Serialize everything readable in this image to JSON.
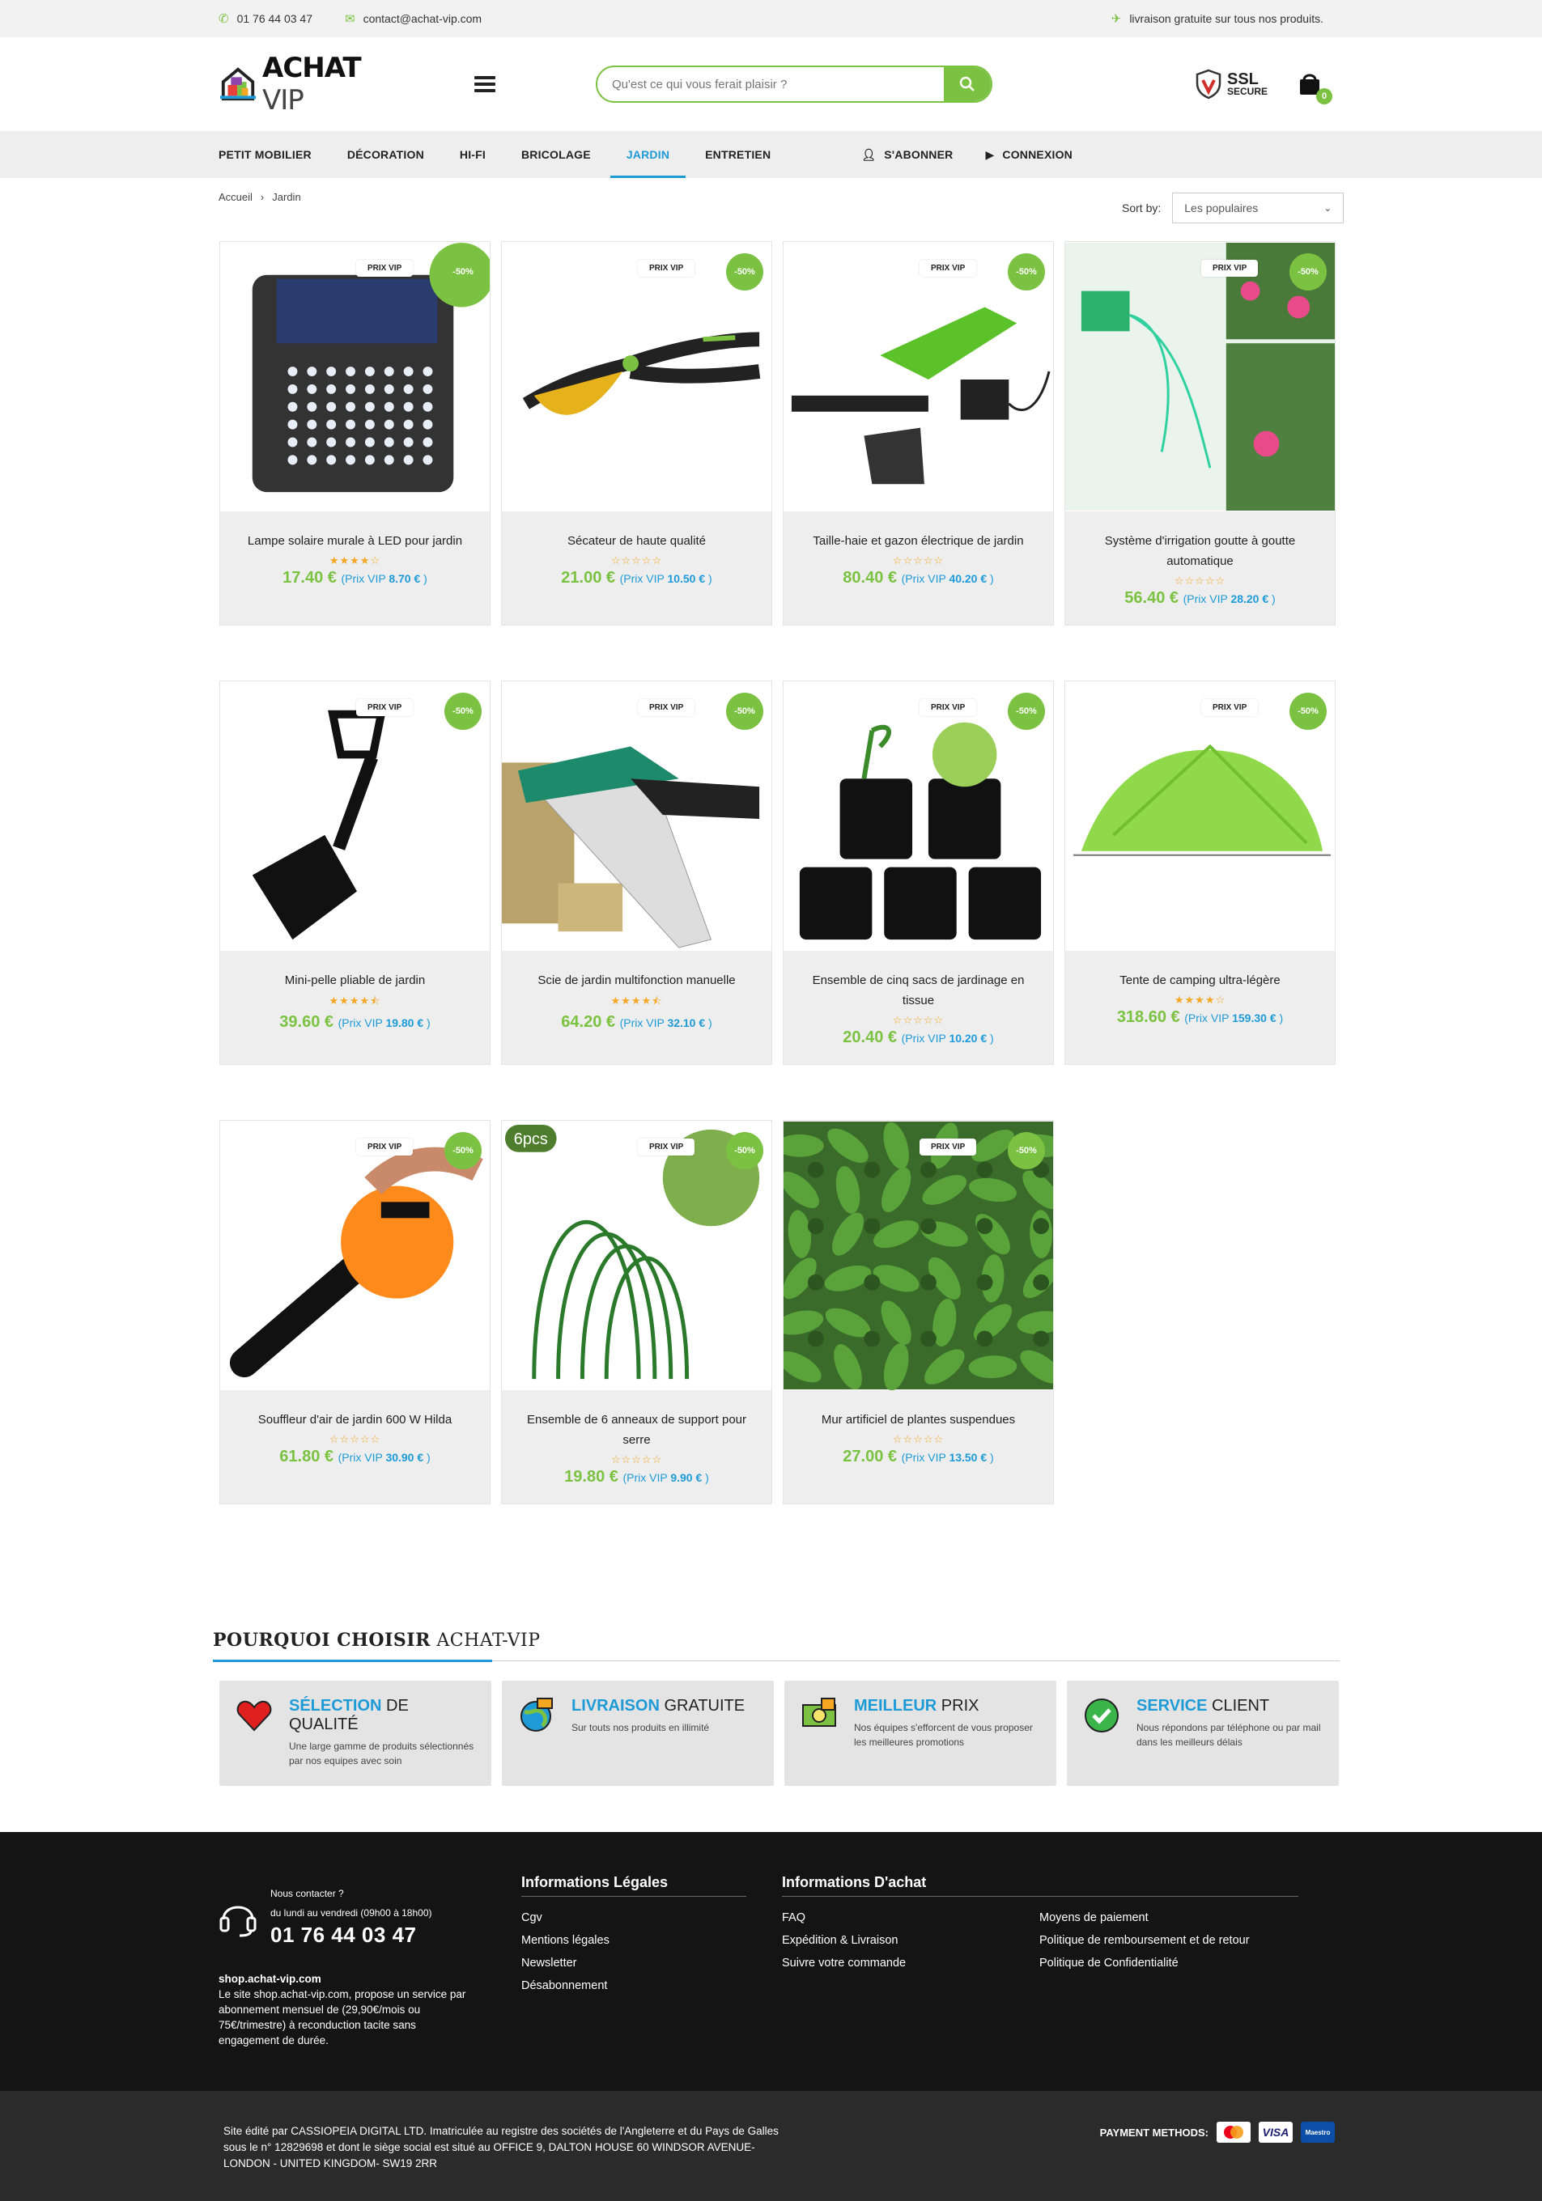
{
  "topbar": {
    "phone": "01 76 44 03 47",
    "email": "contact@achat-vip.com",
    "shipping": "livraison gratuite sur tous nos produits."
  },
  "header": {
    "logo_bold": "ACHAT",
    "logo_light": "VIP",
    "search_placeholder": "Qu'est ce qui vous ferait plaisir ?",
    "ssl_title": "SSL",
    "ssl_sub": "SECURE",
    "cart_count": "0"
  },
  "nav": {
    "items": [
      "PETIT MOBILIER",
      "DÉCORATION",
      "HI-FI",
      "BRICOLAGE",
      "JARDIN",
      "ENTRETIEN"
    ],
    "active_index": 4,
    "subscribe": "S'ABONNER",
    "login": "CONNEXION"
  },
  "breadcrumb": {
    "home": "Accueil",
    "separator": "›",
    "current": "Jardin"
  },
  "sort": {
    "label": "Sort by:",
    "value": "Les populaires"
  },
  "product_labels": {
    "badge": "PRIX VIP",
    "discount": "-50%",
    "vip_prefix": "(Prix VIP",
    "vip_suffix": ")"
  },
  "products": [
    {
      "name": "Lampe solaire murale à LED pour jardin",
      "price": "17.40 €",
      "vip": "8.70 €",
      "rating": 4
    },
    {
      "name": "Sécateur de haute qualité",
      "price": "21.00 €",
      "vip": "10.50 €",
      "rating": 0
    },
    {
      "name": "Taille-haie et gazon électrique de jardin",
      "price": "80.40 €",
      "vip": "40.20 €",
      "rating": 0
    },
    {
      "name": "Système d'irrigation goutte à goutte automatique",
      "price": "56.40 €",
      "vip": "28.20 €",
      "rating": 0
    },
    {
      "name": "Mini-pelle pliable de jardin",
      "price": "39.60 €",
      "vip": "19.80 €",
      "rating": 4.5
    },
    {
      "name": "Scie de jardin multifonction manuelle",
      "price": "64.20 €",
      "vip": "32.10 €",
      "rating": 4.5
    },
    {
      "name": "Ensemble de cinq sacs de jardinage en tissue",
      "price": "20.40 €",
      "vip": "10.20 €",
      "rating": 0
    },
    {
      "name": "Tente de camping ultra-légère",
      "price": "318.60 €",
      "vip": "159.30 €",
      "rating": 4
    },
    {
      "name": "Souffleur d'air de jardin 600 W Hilda",
      "price": "61.80 €",
      "vip": "30.90 €",
      "rating": 0
    },
    {
      "name": "Ensemble de 6 anneaux de support pour serre",
      "price": "19.80 €",
      "vip": "9.90 €",
      "rating": 0
    },
    {
      "name": "Mur artificiel de plantes suspendues",
      "price": "27.00 €",
      "vip": "13.50 €",
      "rating": 0
    }
  ],
  "why": {
    "title_bold": "POURQUOI CHOISIR",
    "title_light": "ACHAT-VIP",
    "boxes": [
      {
        "bold": "SÉLECTION",
        "light": "DE QUALITÉ",
        "text": "Une large gamme de produits sélectionnés par nos equipes avec soin",
        "icon": "heart-icon"
      },
      {
        "bold": "LIVRAISON",
        "light": "GRATUITE",
        "text": "Sur touts nos produits en illimité",
        "icon": "globe-delivery-icon"
      },
      {
        "bold": "MEILLEUR",
        "light": "PRIX",
        "text": "Nos équipes s'efforcent de vous proposer les meilleures promotions",
        "icon": "money-icon"
      },
      {
        "bold": "SERVICE",
        "light": "CLIENT",
        "text": "Nous répondons par téléphone ou par mail dans les meilleurs délais",
        "icon": "check-icon"
      }
    ]
  },
  "footer": {
    "contact_label": "Nous contacter ?",
    "hours": "du lundi au vendredi (09h00 à 18h00)",
    "phone": "01 76 44 03 47",
    "site": "shop.achat-vip.com",
    "about": "Le site shop.achat-vip.com, propose un service par abonnement mensuel de (29,90€/mois ou 75€/trimestre) à reconduction tacite sans engagement de durée.",
    "legal_title": "Informations Légales",
    "legal_links": [
      "Cgv",
      "Mentions légales",
      "Newsletter",
      "Désabonnement"
    ],
    "buy_title": "Informations D'achat",
    "buy_links_1": [
      "FAQ",
      "Expédition & Livraison",
      "Suivre votre commande"
    ],
    "buy_links_2": [
      "Moyens de paiement",
      "Politique de remboursement et de retour",
      "Politique de Confidentialité"
    ]
  },
  "bottom": {
    "legal": "Site édité par CASSIOPEIA DIGITAL LTD. Imatriculée au registre des sociétés de l'Angleterre et du Pays de Galles sous le n° 12829698 et dont le siège social est situé au OFFICE 9, DALTON HOUSE 60 WINDSOR AVENUE- LONDON - UNITED KINGDOM- SW19 2RR",
    "payment_label": "PAYMENT METHODS:",
    "cards": [
      "mastercard",
      "VISA",
      "Maestro"
    ]
  },
  "colors": {
    "accent_green": "#7cc242",
    "accent_blue": "#1e9bd7",
    "star": "#f5a623"
  }
}
